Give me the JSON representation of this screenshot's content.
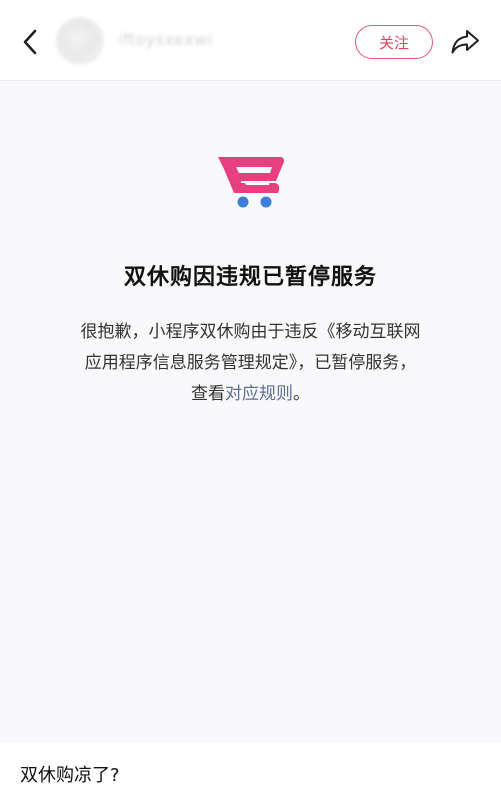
{
  "header": {
    "username": "iftoysxexwi",
    "follow_label": "关注"
  },
  "notice": {
    "title": "双休购因违规已暂停服务",
    "body_line1": "很抱歉，小程序双休购由于违反《移动互联网",
    "body_line2": "应用程序信息服务管理规定》，已暂停服务，",
    "body_line3_prefix": "查看",
    "rules_link": "对应规则",
    "body_line3_suffix": "。"
  },
  "post": {
    "title": "双休购凉了?"
  },
  "colors": {
    "accent": "#e2435e",
    "cart_pink": "#e8407f",
    "cart_wheels": "#3d7fd8",
    "link": "#5a6f96",
    "notice_bg": "#f9f9fb"
  },
  "icons": [
    "back-arrow-icon",
    "share-icon",
    "shopping-cart-icon"
  ]
}
